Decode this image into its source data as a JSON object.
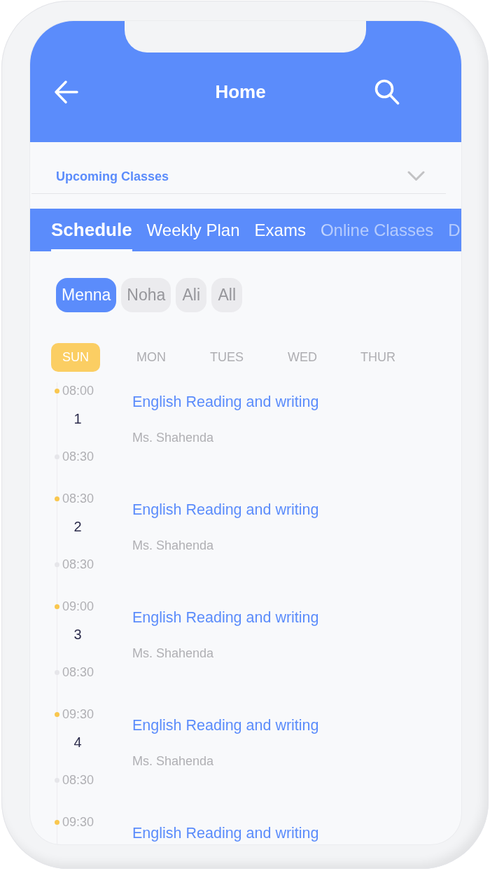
{
  "header": {
    "title": "Home"
  },
  "upcoming": {
    "label": "Upcoming Classes",
    "expanded": false
  },
  "tabs": [
    {
      "label": "Schedule",
      "selected": true
    },
    {
      "label": "Weekly Plan",
      "selected": false
    },
    {
      "label": "Exams",
      "selected": false
    },
    {
      "label": "Online Classes",
      "selected": false
    },
    {
      "label": "D",
      "selected": false
    }
  ],
  "students": [
    {
      "name": "Menna",
      "selected": true
    },
    {
      "name": "Noha",
      "selected": false
    },
    {
      "name": "Ali",
      "selected": false
    },
    {
      "name": "All",
      "selected": false
    }
  ],
  "days": [
    {
      "label": "SUN",
      "selected": true
    },
    {
      "label": "MON",
      "selected": false
    },
    {
      "label": "TUES",
      "selected": false
    },
    {
      "label": "WED",
      "selected": false
    },
    {
      "label": "THUR",
      "selected": false
    }
  ],
  "classes": [
    {
      "start": "08:00",
      "number": "1",
      "end": "08:30",
      "title": "English Reading and writing",
      "teacher": "Ms. Shahenda"
    },
    {
      "start": "08:30",
      "number": "2",
      "end": "08:30",
      "title": "English Reading and writing",
      "teacher": "Ms. Shahenda"
    },
    {
      "start": "09:00",
      "number": "3",
      "end": "08:30",
      "title": "English Reading and writing",
      "teacher": "Ms. Shahenda"
    },
    {
      "start": "09:30",
      "number": "4",
      "end": "08:30",
      "title": "English Reading and writing",
      "teacher": "Ms. Shahenda"
    },
    {
      "start": "09:30",
      "title": "English Reading and writing"
    }
  ]
}
